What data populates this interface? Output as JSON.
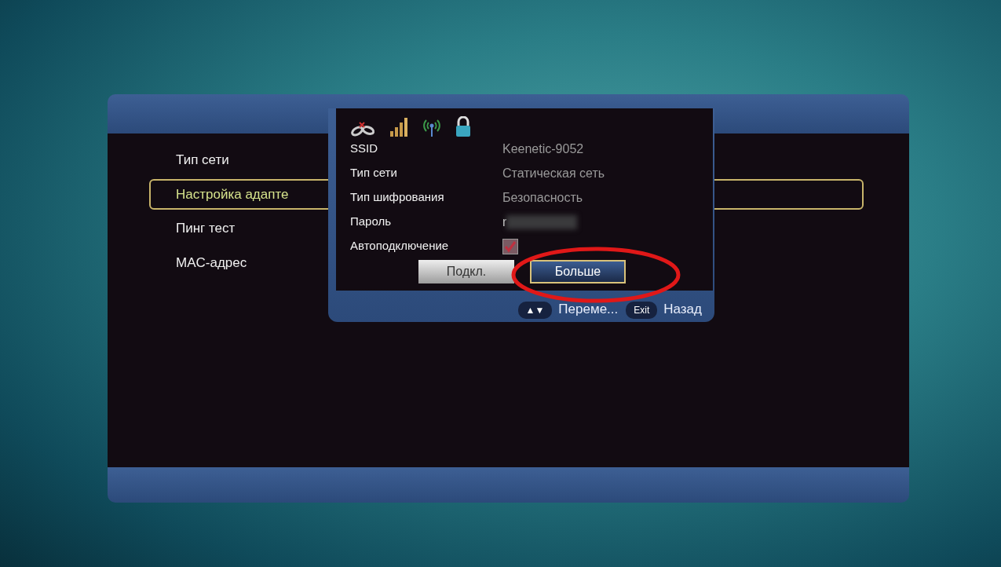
{
  "menu": {
    "items": [
      {
        "label": "Тип сети",
        "selected": false
      },
      {
        "label": "Настройка адапте",
        "selected": true
      },
      {
        "label": "Пинг тест",
        "selected": false
      },
      {
        "label": "MAC-адрес",
        "selected": false
      }
    ]
  },
  "dialog": {
    "fields": [
      {
        "kind": "text",
        "label": "SSID",
        "value": "Keenetic-9052"
      },
      {
        "kind": "text",
        "label": "Тип сети",
        "value": "Статическая сеть"
      },
      {
        "kind": "text",
        "label": "Тип шифрования",
        "value": "Безопасность"
      },
      {
        "kind": "password",
        "label": "Пароль",
        "value": "r"
      },
      {
        "kind": "checkbox",
        "label": "Автоподключение",
        "checked": true
      }
    ],
    "buttons": [
      {
        "label": "Подкл.",
        "selected": false
      },
      {
        "label": "Больше",
        "selected": true
      }
    ],
    "hints": [
      {
        "key": "▲▼",
        "label": "Переме..."
      },
      {
        "key": "Exit",
        "label": "Назад"
      }
    ]
  }
}
